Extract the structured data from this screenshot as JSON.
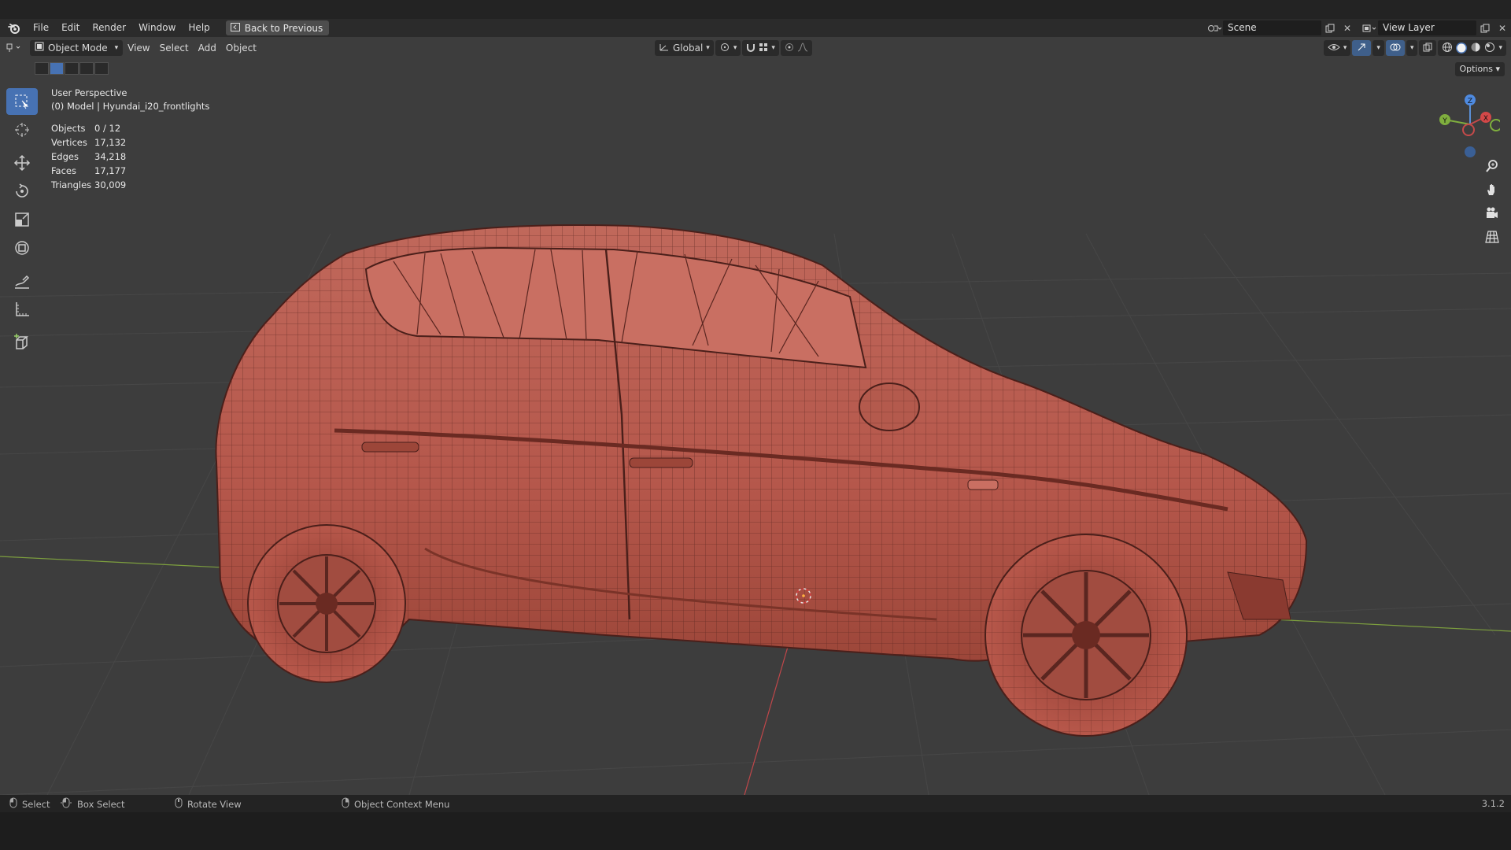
{
  "menubar": {
    "items": [
      "File",
      "Edit",
      "Render",
      "Window",
      "Help"
    ],
    "back_button": "Back to Previous",
    "scene_field": "Scene",
    "view_layer_field": "View Layer"
  },
  "viewport_header": {
    "mode": "Object Mode",
    "menus": [
      "View",
      "Select",
      "Add",
      "Object"
    ],
    "orientation": "Global",
    "options": "Options"
  },
  "overlay": {
    "view_name": "User Perspective",
    "collection_object": "(0) Model | Hyundai_i20_frontlights",
    "stats": [
      {
        "label": "Objects",
        "value": "0 / 12"
      },
      {
        "label": "Vertices",
        "value": "17,132"
      },
      {
        "label": "Edges",
        "value": "34,218"
      },
      {
        "label": "Faces",
        "value": "17,177"
      },
      {
        "label": "Triangles",
        "value": "30,009"
      }
    ]
  },
  "gizmo": {
    "x": "X",
    "y": "Y",
    "z": "Z"
  },
  "toolbar": [
    "select-box",
    "cursor",
    "move",
    "rotate",
    "scale",
    "transform",
    "annotate",
    "measure",
    "add-cube"
  ],
  "statusbar": {
    "select": "Select",
    "box_select": "Box Select",
    "rotate_view": "Rotate View",
    "context_menu": "Object Context Menu",
    "version": "3.1.2"
  },
  "colors": {
    "viewport_bg": "#3d3d3d",
    "mesh": "#b5574b",
    "active_tool": "#4772b3",
    "x_axis": "#c54a4a",
    "y_axis": "#6a9a3a"
  }
}
